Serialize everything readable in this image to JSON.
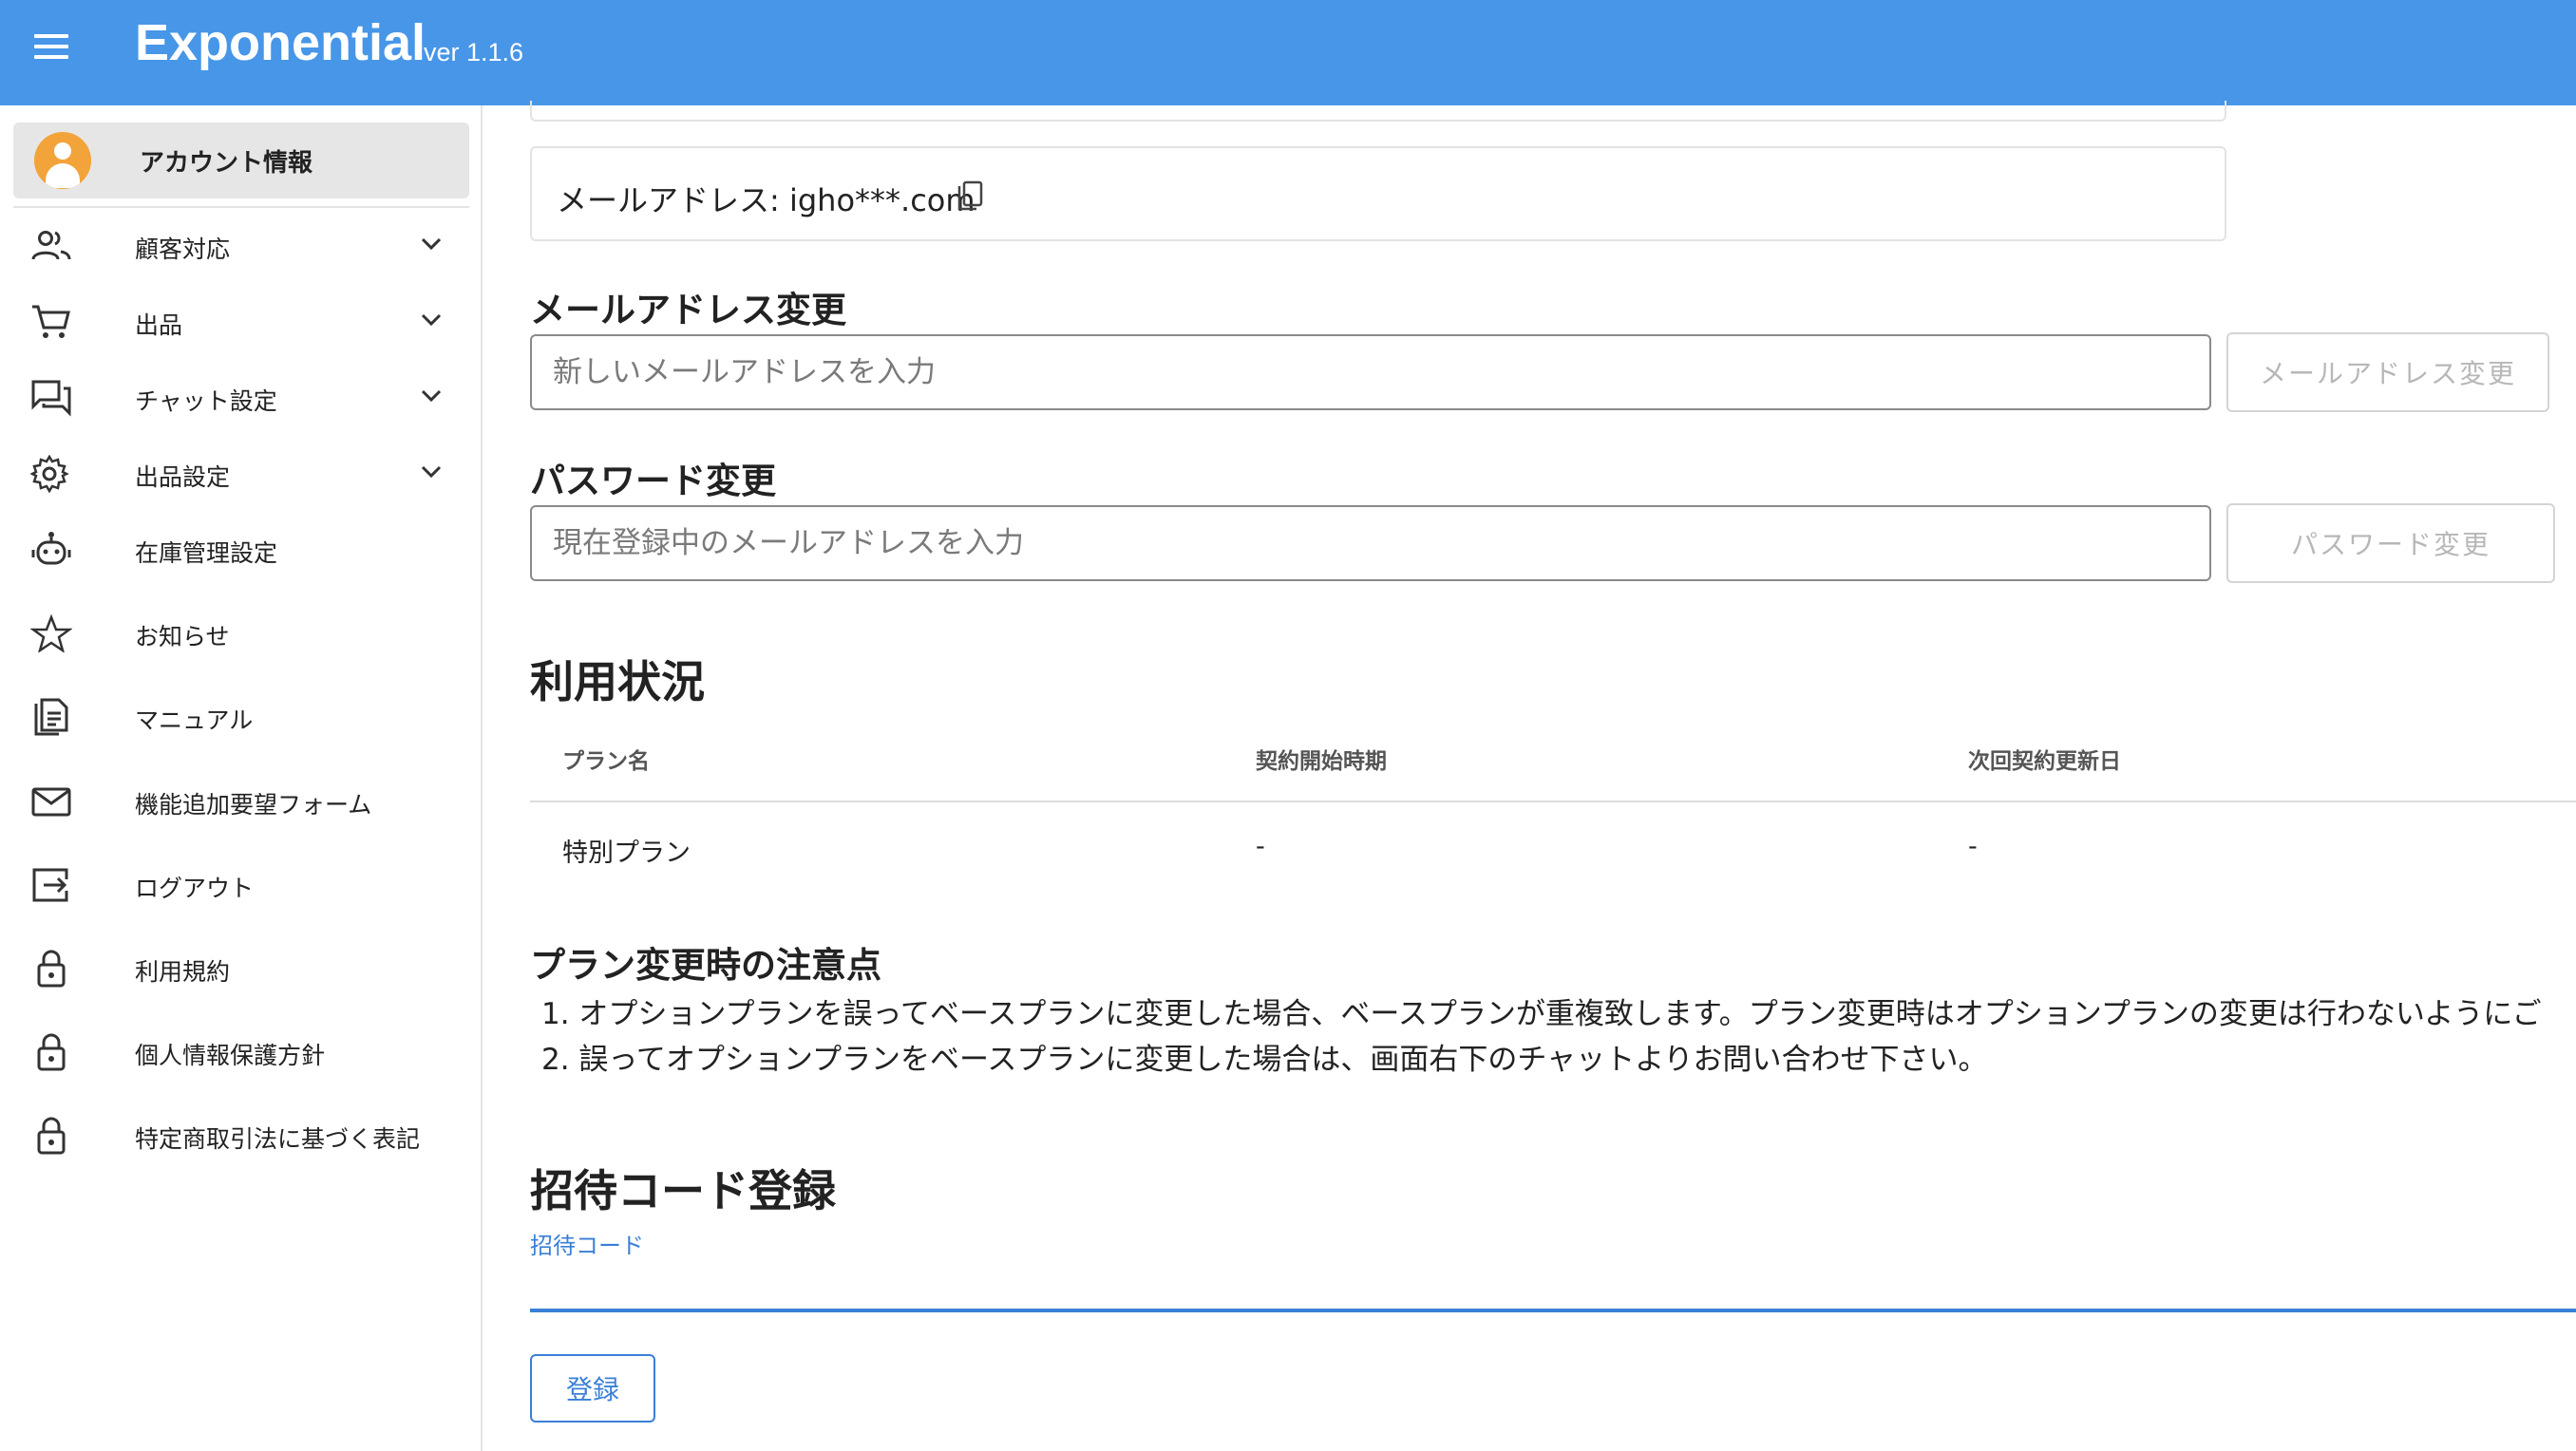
{
  "app": {
    "title": "Exponential",
    "version": "ver 1.1.6"
  },
  "sidebar": {
    "account_label": "アカウント情報",
    "items": [
      {
        "label": "顧客対応",
        "icon": "people-icon",
        "expandable": true
      },
      {
        "label": "出品",
        "icon": "cart-icon",
        "expandable": true
      },
      {
        "label": "チャット設定",
        "icon": "chat-icon",
        "expandable": true
      },
      {
        "label": "出品設定",
        "icon": "gear-icon",
        "expandable": true
      },
      {
        "label": "在庫管理設定",
        "icon": "robot-icon",
        "expandable": false
      },
      {
        "label": "お知らせ",
        "icon": "star-icon",
        "expandable": false
      },
      {
        "label": "マニュアル",
        "icon": "document-icon",
        "expandable": false
      },
      {
        "label": "機能追加要望フォーム",
        "icon": "mail-icon",
        "expandable": false
      },
      {
        "label": "ログアウト",
        "icon": "logout-icon",
        "expandable": false
      },
      {
        "label": "利用規約",
        "icon": "lock-icon",
        "expandable": false
      },
      {
        "label": "個人情報保護方針",
        "icon": "lock-icon",
        "expandable": false
      },
      {
        "label": "特定商取引法に基づく表記",
        "icon": "lock-icon",
        "expandable": false
      }
    ]
  },
  "account": {
    "email_text": "メールアドレス: igho***.com",
    "email_change": {
      "heading": "メールアドレス変更",
      "placeholder": "新しいメールアドレスを入力",
      "button": "メールアドレス変更"
    },
    "password_change": {
      "heading": "パスワード変更",
      "placeholder": "現在登録中のメールアドレスを入力",
      "button": "パスワード変更"
    }
  },
  "usage": {
    "heading": "利用状況",
    "columns": [
      "プラン名",
      "契約開始時期",
      "次回契約更新日"
    ],
    "rows": [
      [
        "特別プラン",
        "-",
        "-"
      ]
    ]
  },
  "notes": {
    "heading": "プラン変更時の注意点",
    "items": [
      "1. オプションプランを誤ってベースプランに変更した場合、ベースプランが重複致します。プラン変更時はオプションプランの変更は行わないようにご",
      "2. 誤ってオプションプランをベースプランに変更した場合は、画面右下のチャットよりお問い合わせ下さい。"
    ]
  },
  "invite": {
    "heading": "招待コード登録",
    "field_label": "招待コード",
    "value": "",
    "button": "登録"
  },
  "colors": {
    "appbar": "#4796e8",
    "accent": "#3a7fd6",
    "avatar": "#f2a33a"
  }
}
